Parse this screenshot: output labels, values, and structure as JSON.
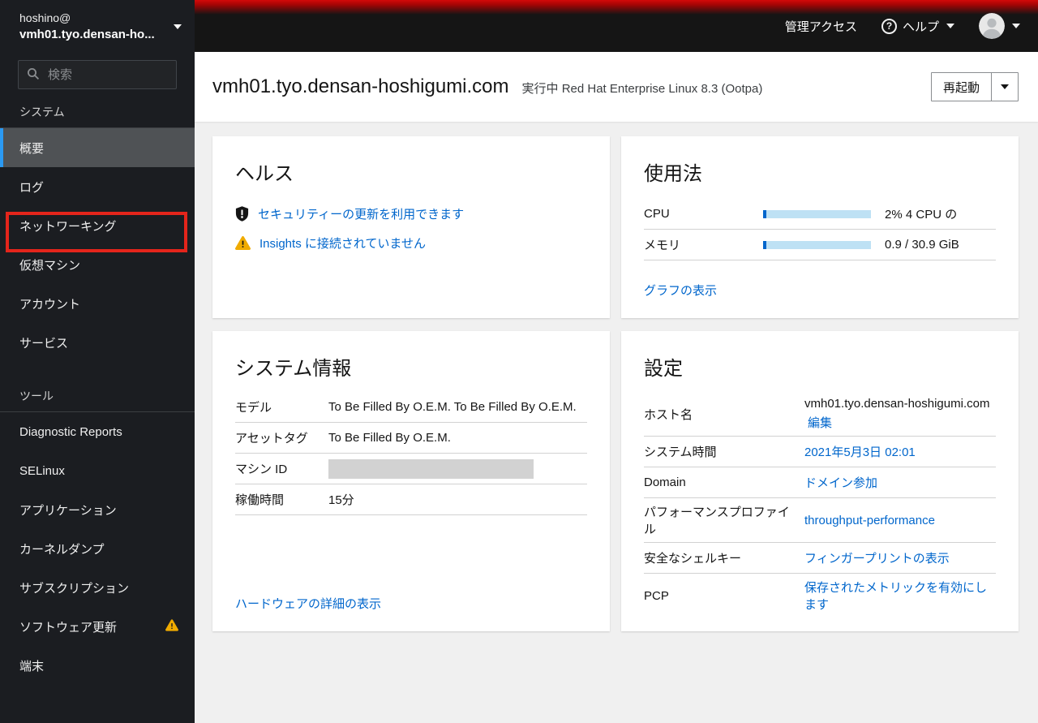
{
  "colors": {
    "masthead_accent_red": "#d40909",
    "link_blue": "#0066cc",
    "warning_yellow": "#f0ab00",
    "annotation_red": "#e4251b",
    "active_nav_blue": "#2b9af3"
  },
  "masthead": {
    "admin_access": "管理アクセス",
    "help": "ヘルプ"
  },
  "sidebar": {
    "user": "hoshino@",
    "host": "vmh01.tyo.densan-ho...",
    "search_placeholder": "検索",
    "sections": [
      {
        "label": "システム",
        "items": [
          {
            "label": "概要"
          },
          {
            "label": "ログ"
          },
          {
            "label": "ネットワーキング"
          },
          {
            "label": "仮想マシン"
          },
          {
            "label": "アカウント"
          },
          {
            "label": "サービス"
          }
        ]
      },
      {
        "label": "ツール",
        "items": [
          {
            "label": "Diagnostic Reports"
          },
          {
            "label": "SELinux"
          },
          {
            "label": "アプリケーション"
          },
          {
            "label": "カーネルダンプ"
          },
          {
            "label": "サブスクリプション"
          },
          {
            "label": "ソフトウェア更新"
          },
          {
            "label": "端末"
          }
        ]
      }
    ]
  },
  "page_header": {
    "hostname": "vmh01.tyo.densan-hoshigumi.com",
    "status": "実行中 Red Hat Enterprise Linux 8.3 (Ootpa)",
    "restart": "再起動"
  },
  "cards": {
    "health": {
      "title": "ヘルス",
      "items": [
        {
          "icon": "security-shield-icon",
          "text": "セキュリティーの更新を利用できます"
        },
        {
          "icon": "warning-triangle-icon",
          "text": "Insights に接続されていません"
        }
      ]
    },
    "usage": {
      "title": "使用法",
      "cpu_label": "CPU",
      "cpu_value": "2% 4 CPU の",
      "cpu_percent": 3,
      "mem_label": "メモリ",
      "mem_value": "0.9 / 30.9 GiB",
      "mem_percent": 3,
      "link": "グラフの表示"
    },
    "system_info": {
      "title": "システム情報",
      "rows": [
        {
          "label": "モデル",
          "value": "To Be Filled By O.E.M. To Be Filled By O.E.M."
        },
        {
          "label": "アセットタグ",
          "value": "To Be Filled By O.E.M."
        },
        {
          "label": "マシン ID",
          "value": ""
        },
        {
          "label": "稼働時間",
          "value": "15分"
        }
      ],
      "link": "ハードウェアの詳細の表示"
    },
    "config": {
      "title": "設定",
      "rows": [
        {
          "label": "ホスト名",
          "value": "vmh01.tyo.densan-hoshigumi.com",
          "link": "編集"
        },
        {
          "label": "システム時間",
          "link": "2021年5月3日 02:01"
        },
        {
          "label": "Domain",
          "link": "ドメイン参加"
        },
        {
          "label": "パフォーマンスプロファイル",
          "link": "throughput-performance"
        },
        {
          "label": "安全なシェルキー",
          "link": "フィンガープリントの表示"
        },
        {
          "label": "PCP",
          "link": "保存されたメトリックを有効にします"
        }
      ]
    }
  }
}
